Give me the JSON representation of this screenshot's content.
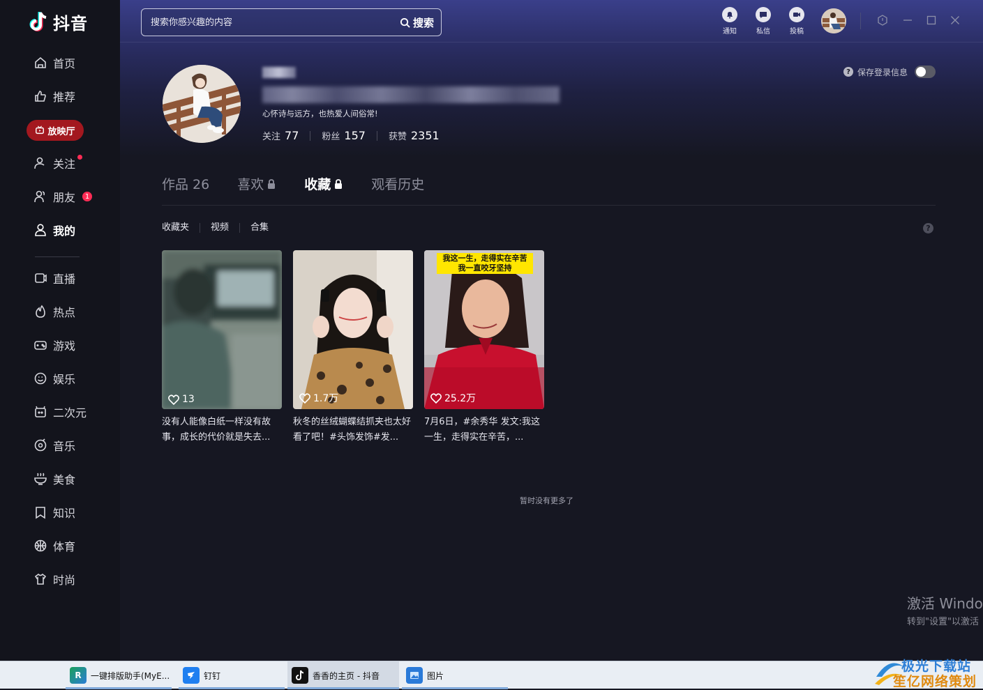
{
  "app": {
    "name": "抖音"
  },
  "search": {
    "placeholder": "搜索你感兴趣的内容",
    "button_label": "搜索"
  },
  "top_actions": [
    {
      "label": "通知",
      "icon": "bell-icon"
    },
    {
      "label": "私信",
      "icon": "message-icon"
    },
    {
      "label": "投稿",
      "icon": "upload-icon"
    }
  ],
  "sidebar": {
    "items": [
      {
        "label": "首页",
        "icon": "home-icon"
      },
      {
        "label": "推荐",
        "icon": "thumbs-up-icon"
      },
      {
        "label": "放映厅",
        "icon": "tv-icon"
      },
      {
        "label": "关注",
        "icon": "user-add-icon"
      },
      {
        "label": "朋友",
        "icon": "friends-icon",
        "badge": "1"
      },
      {
        "label": "我的",
        "icon": "user-icon"
      },
      {
        "label": "直播",
        "icon": "live-icon"
      },
      {
        "label": "热点",
        "icon": "flame-icon"
      },
      {
        "label": "游戏",
        "icon": "gamepad-icon"
      },
      {
        "label": "娱乐",
        "icon": "smile-icon"
      },
      {
        "label": "二次元",
        "icon": "anime-icon"
      },
      {
        "label": "音乐",
        "icon": "music-icon"
      },
      {
        "label": "美食",
        "icon": "bowl-icon"
      },
      {
        "label": "知识",
        "icon": "book-icon"
      },
      {
        "label": "体育",
        "icon": "ball-icon"
      },
      {
        "label": "时尚",
        "icon": "shirt-icon"
      }
    ]
  },
  "profile": {
    "bio": "心怀诗与远方，也热爱人间俗常!",
    "following_label": "关注",
    "following": "77",
    "followers_label": "粉丝",
    "followers": "157",
    "likes_label": "获赞",
    "likes": "2351",
    "save_login_label": "保存登录信息"
  },
  "tabs": [
    {
      "label": "作品 26"
    },
    {
      "label": "喜欢"
    },
    {
      "label": "收藏"
    },
    {
      "label": "观看历史"
    }
  ],
  "subtabs": [
    "收藏夹",
    "视频",
    "合集"
  ],
  "videos": [
    {
      "likes": "13",
      "title": "没有人能像白纸一样没有故事，成长的代价就是失去..."
    },
    {
      "likes": "1.7万",
      "title": "秋冬的丝绒蝴蝶结抓夹也太好看了吧！#头饰发饰#发..."
    },
    {
      "likes": "25.2万",
      "title": "7月6日，#余秀华 发文:我这一生，走得实在辛苦，...",
      "caption1": "我这一生，走得实在辛苦",
      "caption2": "我一直咬牙坚持"
    }
  ],
  "no_more": "暂时没有更多了",
  "watermark": {
    "line1": "激活 Windo",
    "line2": "转到\"设置\"以激活"
  },
  "taskbar": [
    {
      "label": "一键排版助手(MyE..."
    },
    {
      "label": "钉钉"
    },
    {
      "label": "香香的主页 - 抖音"
    },
    {
      "label": "图片"
    }
  ],
  "brand_watermark": {
    "line1": "极光下载站",
    "line2": "笙亿网络策划"
  },
  "colors": {
    "accent": "#fe2c55",
    "sidebar_bg": "#13141c",
    "page_bg": "#161722"
  }
}
